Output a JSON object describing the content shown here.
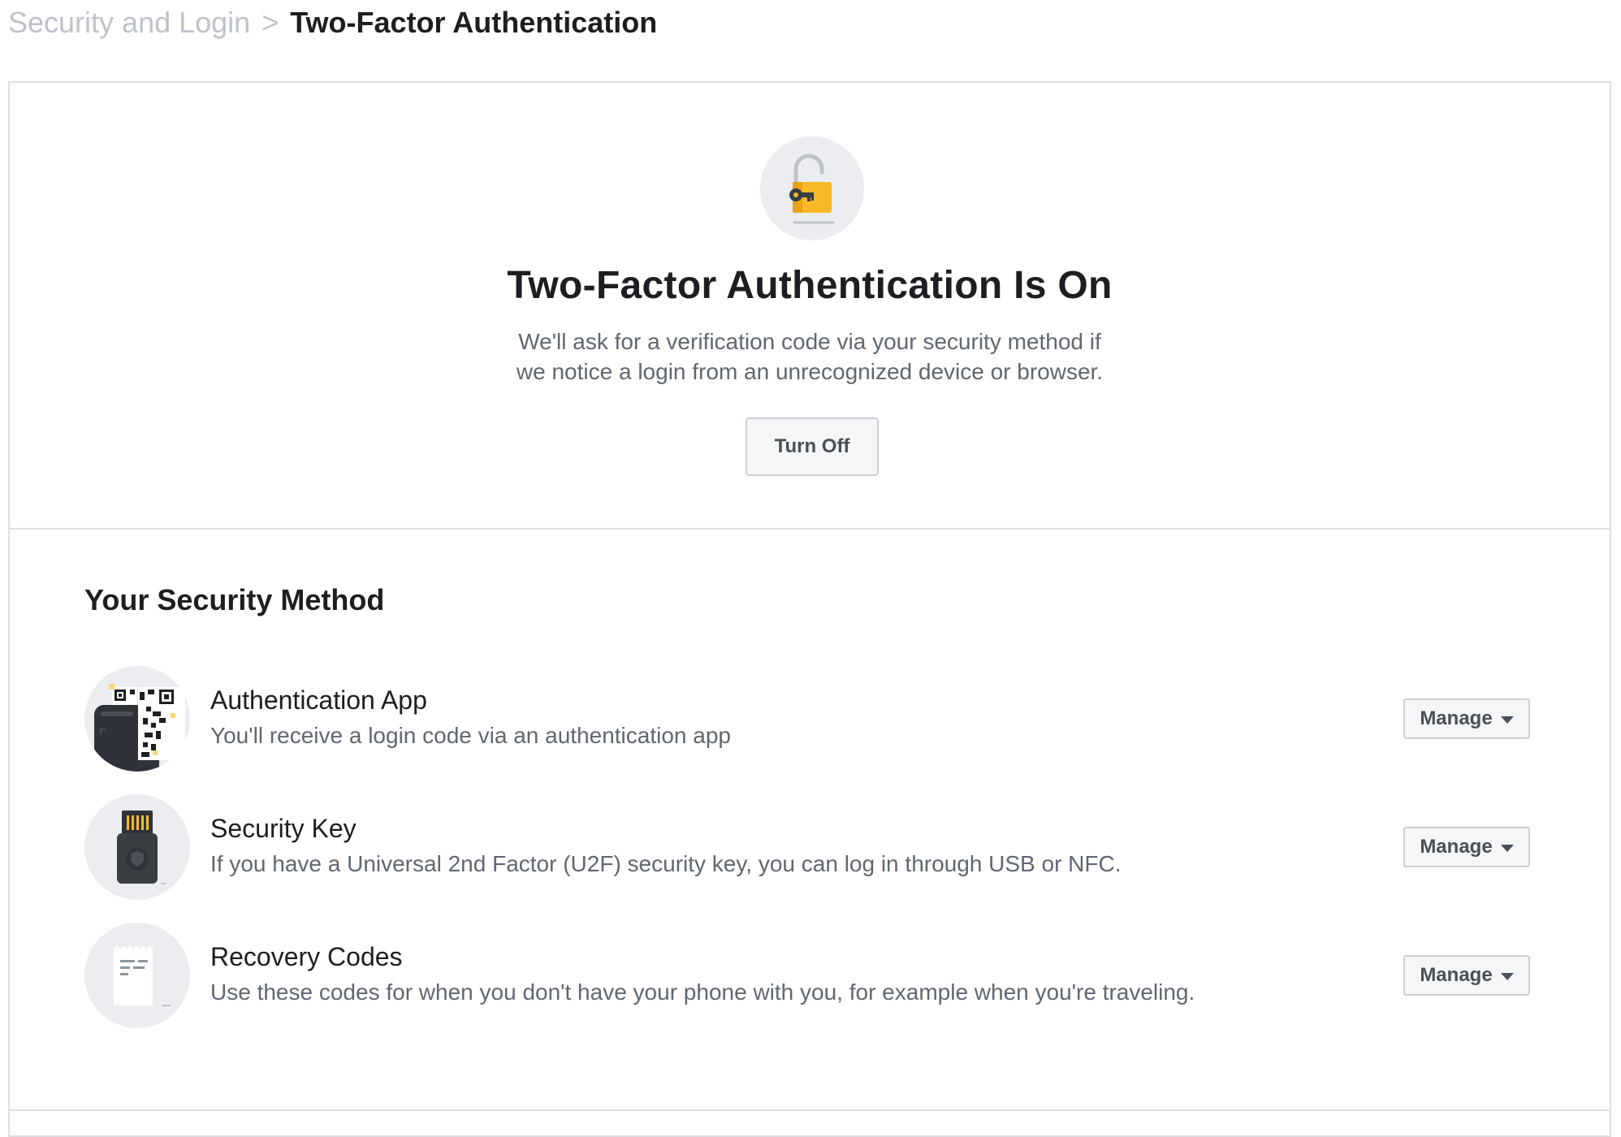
{
  "breadcrumb": {
    "parent": "Security and Login",
    "separator": ">",
    "current": "Two-Factor Authentication"
  },
  "status": {
    "icon": "unlocked-padlock-key-icon",
    "title": "Two-Factor Authentication Is On",
    "description_line1": "We'll ask for a verification code via your security method if",
    "description_line2": "we notice a login from an unrecognized device or browser.",
    "turn_off_label": "Turn Off"
  },
  "methods": {
    "title": "Your Security Method",
    "items": [
      {
        "icon": "authentication-app-qr-icon",
        "name": "Authentication App",
        "description": "You'll receive a login code via an authentication app",
        "action_label": "Manage"
      },
      {
        "icon": "usb-security-key-icon",
        "name": "Security Key",
        "description": "If you have a Universal 2nd Factor (U2F) security key, you can log in through USB or NFC.",
        "action_label": "Manage"
      },
      {
        "icon": "recovery-codes-paper-icon",
        "name": "Recovery Codes",
        "description": "Use these codes for when you don't have your phone with you, for example when you're traveling.",
        "action_label": "Manage"
      }
    ]
  },
  "colors": {
    "text_primary": "#1c1e21",
    "text_secondary": "#606770",
    "breadcrumb_muted": "#bec3c9",
    "border": "#dddfe2",
    "button_bg": "#f5f6f7",
    "icon_circle_bg": "#ebedf0",
    "padlock_yellow": "#f7b928"
  }
}
